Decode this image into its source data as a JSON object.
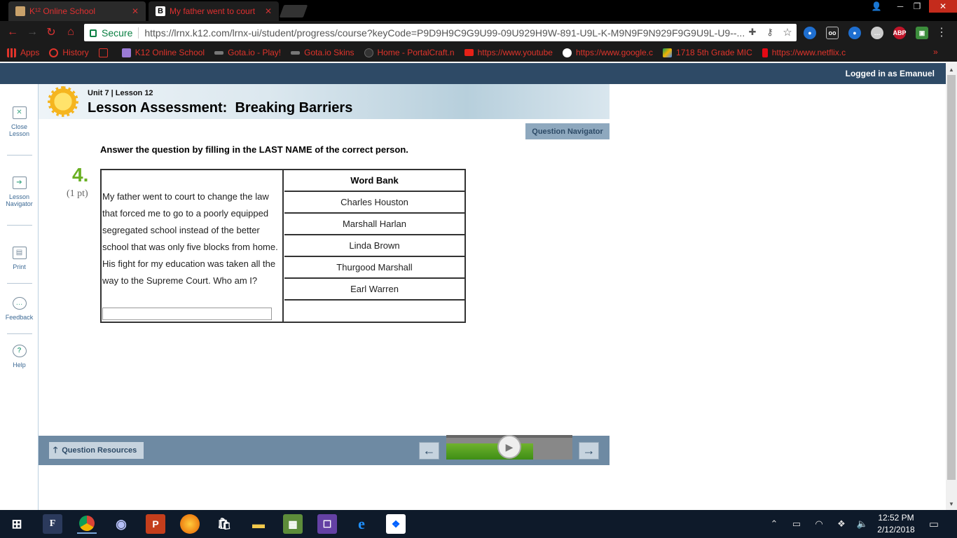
{
  "browser": {
    "tabs": [
      {
        "title": "K¹² Online School"
      },
      {
        "title": "My father went to court"
      }
    ],
    "tab_close": "✕",
    "omnibox": {
      "secure_label": "Secure",
      "url": "https://lrnx.k12.com/lrnx-ui/student/progress/course?keyCode=P9D9H9C9G9U99-09U929H9W-891-U9L-K-M9N9F9N929F9G9U9L-U9--..."
    },
    "extensions": [
      "ABP"
    ],
    "bookmarks": [
      {
        "label": "Apps",
        "color": "#e0342b"
      },
      {
        "label": "History",
        "color": "#e0342b"
      },
      {
        "label": "",
        "color": "#e0342b"
      },
      {
        "label": "K12 Online School",
        "color": "#9b7bd6"
      },
      {
        "label": "Gota.io - Play!",
        "color": "#777"
      },
      {
        "label": "Gota.io Skins",
        "color": "#777"
      },
      {
        "label": "Home - PortalCraft.n",
        "color": "#333"
      },
      {
        "label": "https://www.youtube",
        "color": "#e62117"
      },
      {
        "label": "https://www.google.c",
        "color": "#fff"
      },
      {
        "label": "1718 5th Grade MIC",
        "color": "#f4b400"
      },
      {
        "label": "https://www.netflix.c",
        "color": "#e50914"
      }
    ]
  },
  "page": {
    "logged_in": "Logged in as Emanuel",
    "rail": [
      {
        "label": "Close Lesson"
      },
      {
        "label": "Lesson Navigator"
      },
      {
        "label": "Print"
      },
      {
        "label": "Feedback"
      },
      {
        "label": "Help"
      }
    ],
    "unit": "Unit 7 | Lesson 12",
    "title_prefix": "Lesson Assessment:",
    "title_name": "Breaking Barriers",
    "question_navigator": "Question Navigator",
    "instructions": "Answer the question by filling in the LAST NAME of the correct person.",
    "question_number": "4.",
    "points": "(1 pt)",
    "question_text": "My father went to court to change the law that forced me to go to a poorly equipped segregated school instead of the better school that was only five blocks from home. His fight for my education was taken all the way to the Supreme Court. Who am I?",
    "answer_value": "",
    "word_bank_title": "Word Bank",
    "word_bank": [
      "Charles Houston",
      "Marshall Harlan",
      "Linda Brown",
      "Thurgood Marshall",
      "Earl Warren"
    ],
    "question_resources": "Question Resources",
    "progress_fraction": 0.69
  },
  "taskbar": {
    "time": "12:52 PM",
    "date": "2/12/2018"
  }
}
